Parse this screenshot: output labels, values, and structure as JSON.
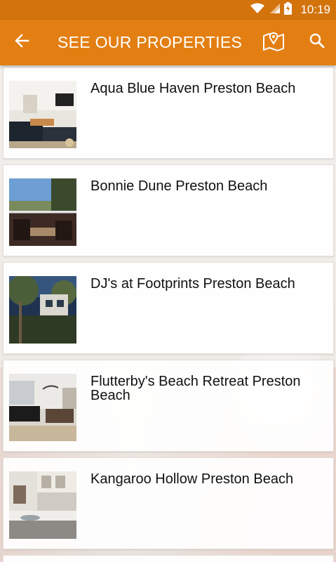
{
  "status": {
    "time": "10:19"
  },
  "toolbar": {
    "title": "SEE OUR PROPERTIES"
  },
  "icons": {
    "back": "arrow-back-icon",
    "map": "map-pin-icon",
    "search": "search-icon",
    "wifi": "wifi-icon",
    "signal": "signal-icon",
    "battery": "battery-charging-icon"
  },
  "colors": {
    "status_bar": "#d2730c",
    "app_bar": "#e37f12"
  },
  "properties": [
    {
      "name": "Aqua Blue Haven Preston Beach"
    },
    {
      "name": "Bonnie Dune Preston Beach"
    },
    {
      "name": "DJ's at Footprints Preston Beach"
    },
    {
      "name": "Flutterby's Beach Retreat Preston Beach"
    },
    {
      "name": "Kangaroo Hollow Preston Beach"
    }
  ]
}
